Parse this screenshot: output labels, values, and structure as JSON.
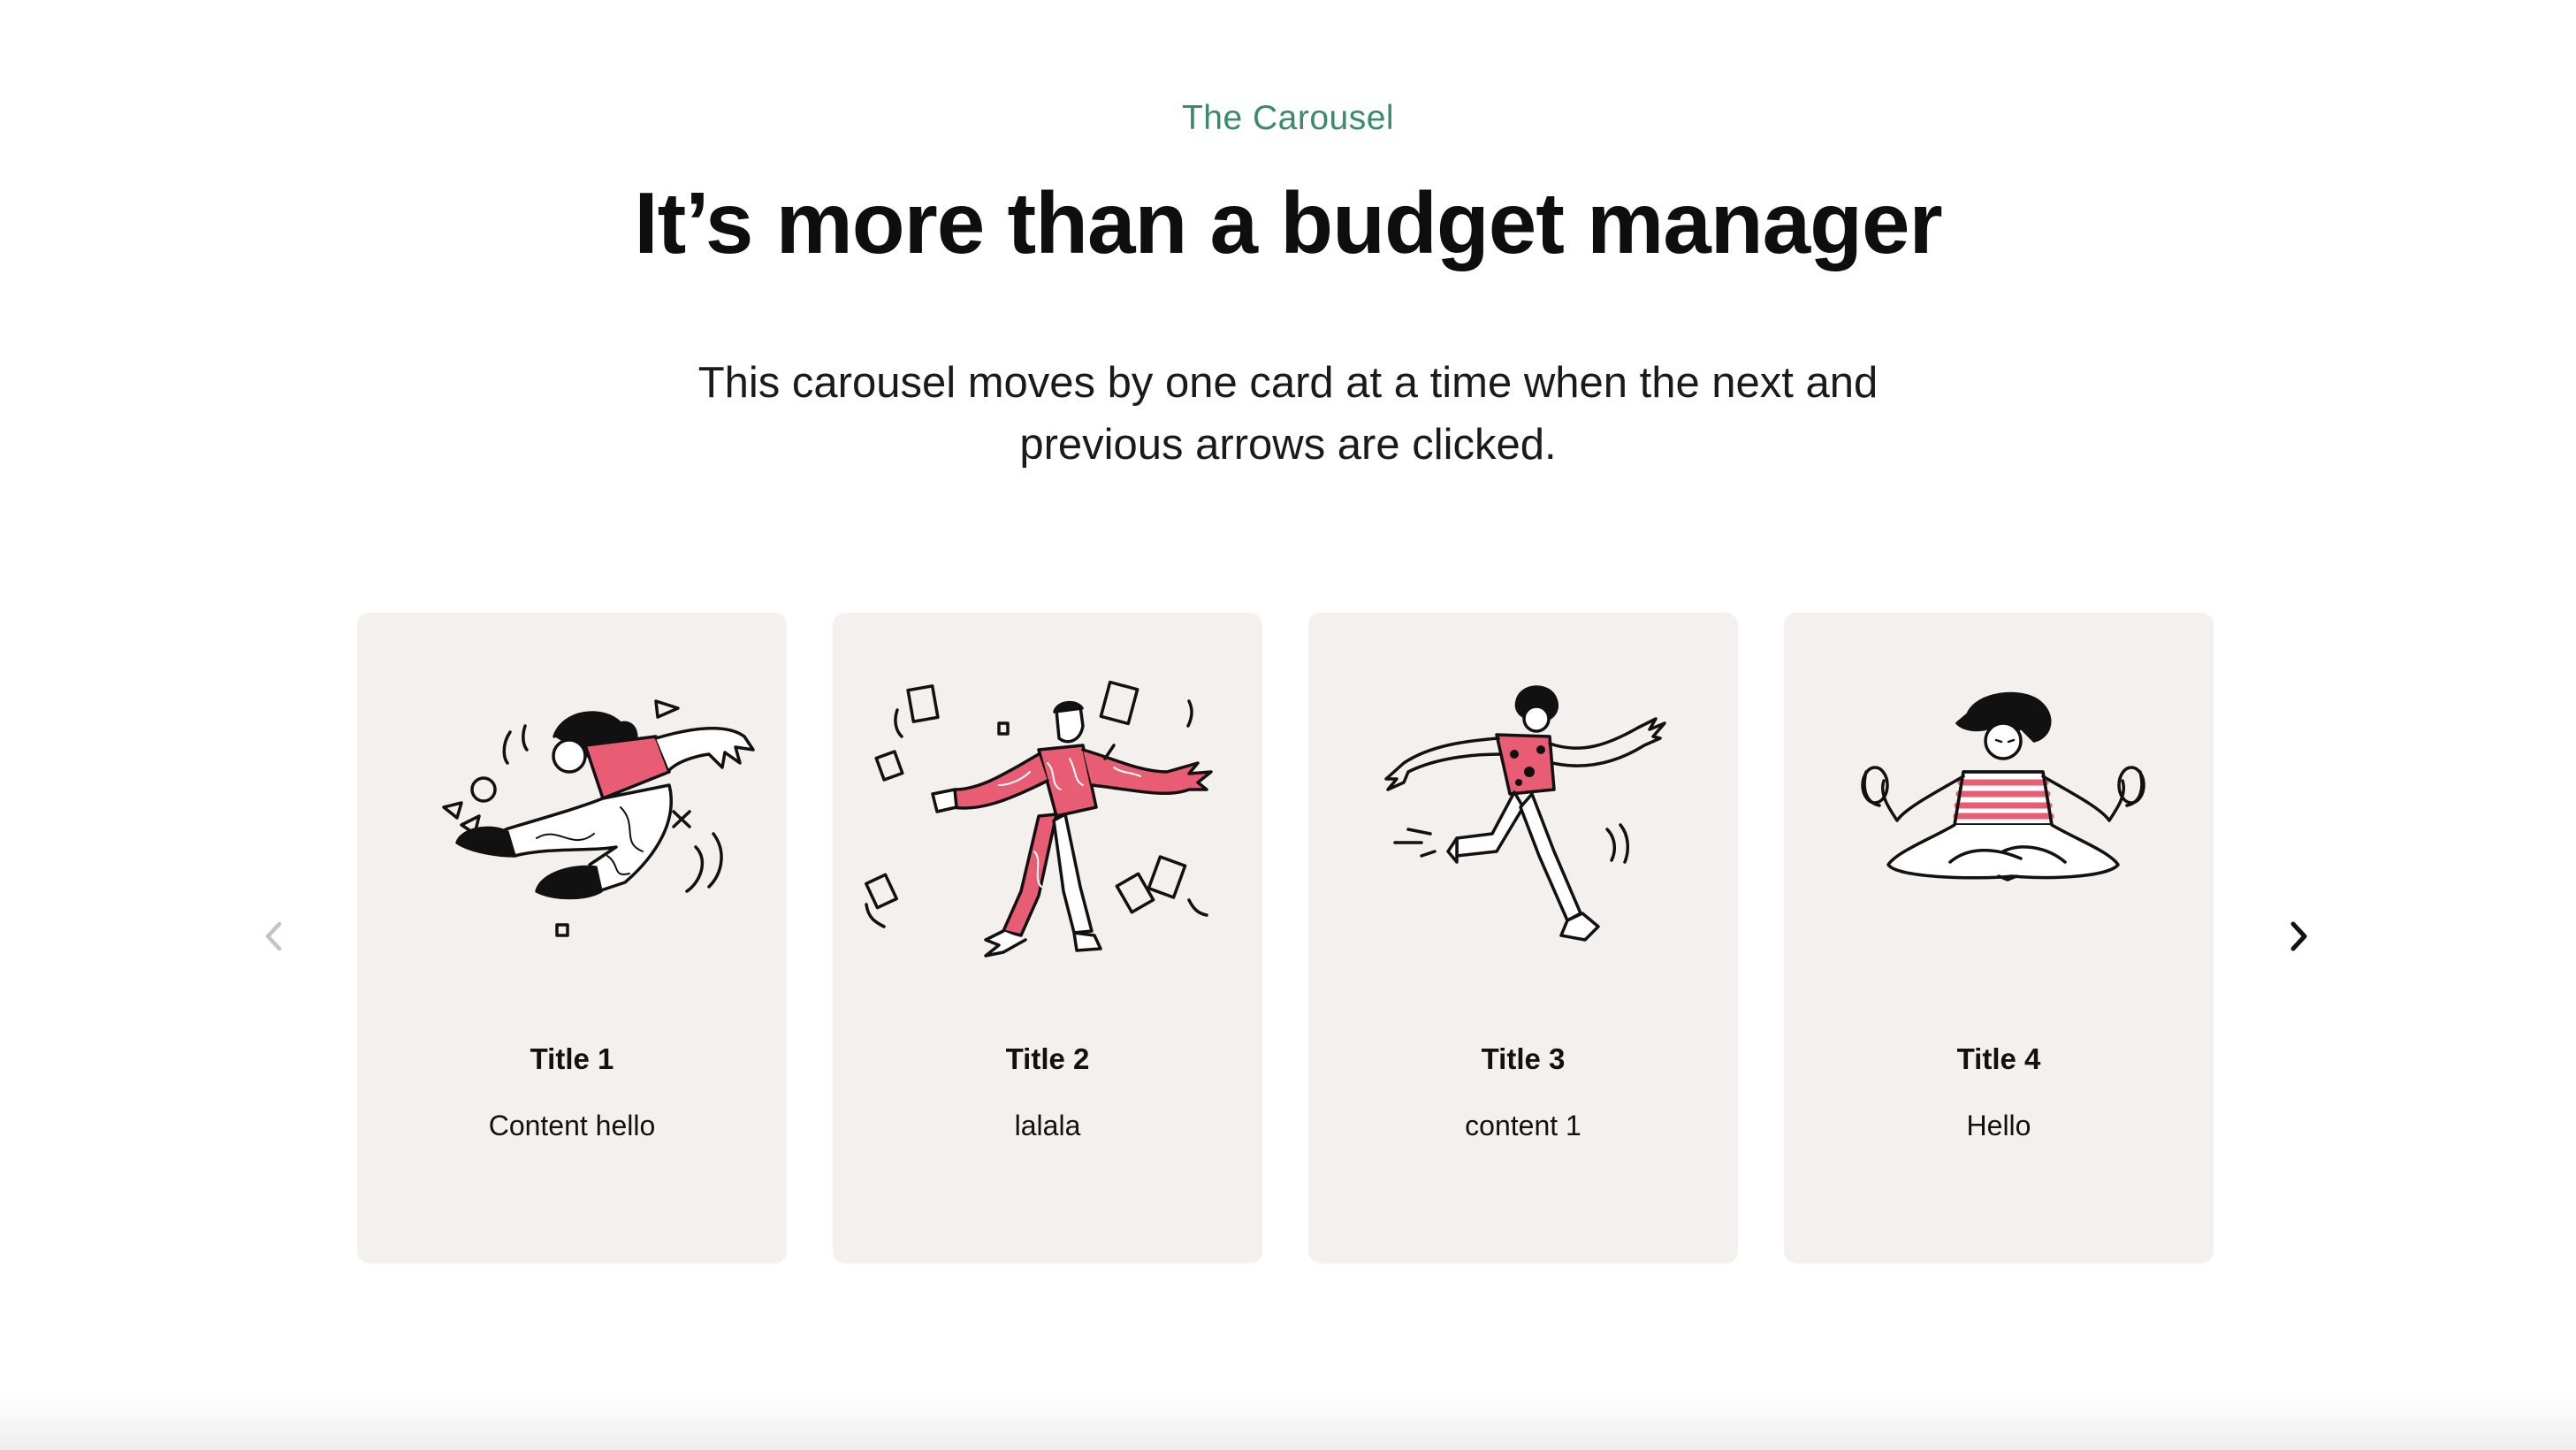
{
  "section": {
    "eyebrow": "The Carousel",
    "heading": "It’s more than a budget manager",
    "description_line1": "This carousel moves by one card at a time when the next and",
    "description_line2": "previous arrows are clicked."
  },
  "carousel": {
    "prev_icon": "chevron-left-icon",
    "next_icon": "chevron-right-icon",
    "cards": [
      {
        "title": "Title 1",
        "content": "Content hello",
        "illustration": "person-flying-illustration"
      },
      {
        "title": "Title 2",
        "content": "lalala",
        "illustration": "person-juggling-papers-illustration"
      },
      {
        "title": "Title 3",
        "content": "content 1",
        "illustration": "person-running-illustration"
      },
      {
        "title": "Title 4",
        "content": "Hello",
        "illustration": "person-meditating-illustration"
      }
    ]
  },
  "colors": {
    "accent": "#3b8a6b",
    "card_background": "#f3f0ee",
    "illustration_accent": "#e95d74",
    "arrow_disabled": "#c4c4c4",
    "arrow_active": "#111111"
  }
}
